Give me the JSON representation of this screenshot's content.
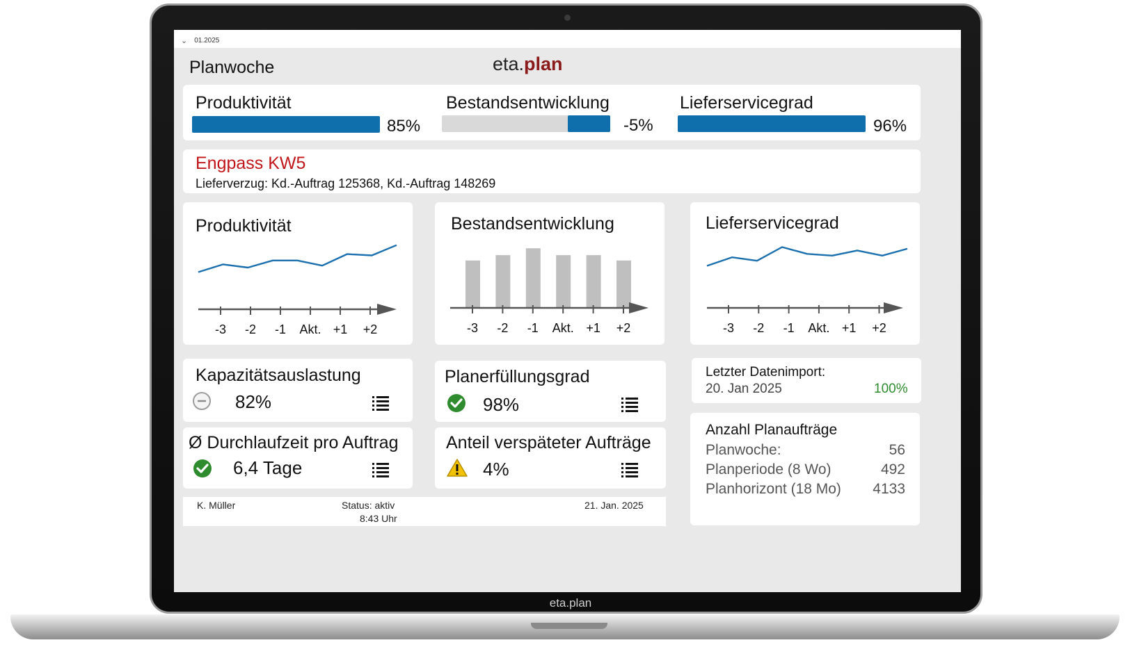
{
  "period": "01.2025",
  "page_title": "Planwoche",
  "brand": {
    "prefix": "eta.",
    "suffix": "plan"
  },
  "bezel_brand": "eta.plan",
  "kpis": [
    {
      "label": "Produktivität",
      "value": "85%"
    },
    {
      "label": "Bestandsentwicklung",
      "value": "-5%"
    },
    {
      "label": "Lieferservicegrad",
      "value": "96%"
    }
  ],
  "alert": {
    "title": "Engpass KW5",
    "text": "Lieferverzug: Kd.-Auftrag 125368, Kd.-Auftrag 148269"
  },
  "charts": {
    "productivity": {
      "title": "Produktivität"
    },
    "inventory": {
      "title": "Bestandsentwicklung"
    },
    "service": {
      "title": "Lieferservicegrad"
    }
  },
  "chart_data": [
    {
      "type": "line",
      "title": "Produktivität",
      "x": [
        "-3",
        "-2",
        "-1",
        "Akt.",
        "+1",
        "+2"
      ],
      "tick_labels": [
        "-3",
        "-2",
        "-1",
        "Akt.",
        "+1",
        "+2"
      ],
      "series": [
        {
          "values": [
            84.6,
            85.8,
            85.3,
            86.4,
            86.4,
            85.6,
            87.4,
            87.2,
            88.8
          ]
        }
      ]
    },
    {
      "type": "bar",
      "title": "Bestandsentwicklung",
      "categories": [
        "-3",
        "-2",
        "-1",
        "Akt.",
        "+1",
        "+2"
      ],
      "tick_labels": [
        "-3",
        "-2",
        "-1",
        "Akt.",
        "+1",
        "+2"
      ],
      "values": [
        62,
        69,
        78,
        69,
        69,
        62
      ]
    },
    {
      "type": "line",
      "title": "Lieferservicegrad",
      "x": [
        "-3",
        "-2",
        "-1",
        "Akt.",
        "+1",
        "+2"
      ],
      "tick_labels": [
        "-3",
        "-2",
        "-1",
        "Akt.",
        "+1",
        "+2"
      ],
      "series": [
        {
          "values": [
            95.7,
            96.2,
            96.0,
            96.8,
            96.4,
            96.3,
            96.6,
            96.3,
            96.7
          ]
        }
      ]
    }
  ],
  "stats": [
    {
      "label": "Kapazitätsauslastung",
      "value": "82%",
      "status_icon": "neutral-circle-icon"
    },
    {
      "label": "Planerfüllungsgrad",
      "value": "98%",
      "status_icon": "check-circle-icon"
    },
    {
      "label": "Ø Durchlaufzeit pro Auftrag",
      "value": "6,4 Tage",
      "status_icon": "check-circle-icon"
    },
    {
      "label": "Anteil verspäteter Aufträge",
      "value": "4%",
      "status_icon": "warning-icon"
    }
  ],
  "import": {
    "label": "Letzter Datenimport:",
    "date": "20. Jan 2025",
    "percent": "100%"
  },
  "orders": {
    "title": "Anzahl Planaufträge",
    "rows": [
      {
        "label": "Planwoche:",
        "value": "56"
      },
      {
        "label": "Planperiode (8 Wo)",
        "value": "492"
      },
      {
        "label": "Planhorizont (18 Mo)",
        "value": "4133"
      }
    ]
  },
  "footer": {
    "user": "K. Müller",
    "status": "Status: aktiv",
    "time": "8:43 Uhr",
    "date": "21. Jan. 2025"
  },
  "colors": {
    "accent": "#0f6fad",
    "alert": "#c0161a",
    "brand_plan": "#8b1a1a",
    "success": "#2e8b2e",
    "warning": "#f2c200"
  }
}
